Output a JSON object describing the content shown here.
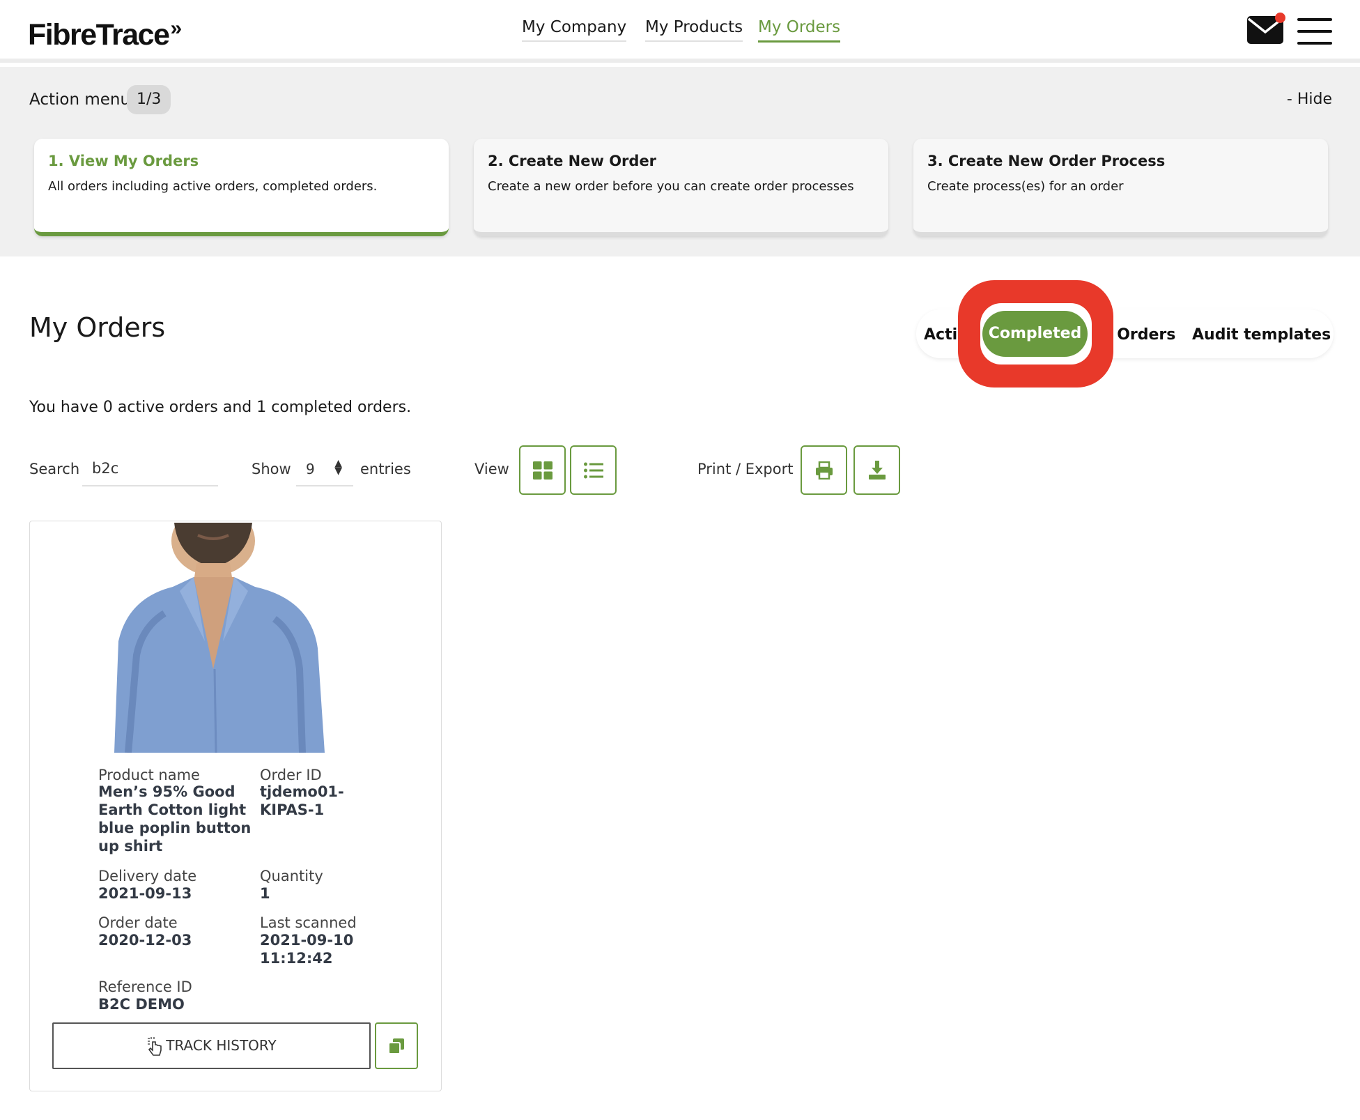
{
  "header": {
    "logo": "FibreTrace",
    "logo_mark": "»",
    "nav": [
      {
        "label": "My Company"
      },
      {
        "label": "My Products"
      },
      {
        "label": "My Orders",
        "active": true
      }
    ],
    "icons": [
      "envelope-icon",
      "notification-dot-icon",
      "hamburger-menu-icon"
    ]
  },
  "action_menu": {
    "title": "Action menu",
    "badge": "1/3",
    "hide_label": "- Hide",
    "cards": [
      {
        "title": "1. View My Orders",
        "description": "All orders including active orders, completed orders.",
        "active": true
      },
      {
        "title": "2. Create New Order",
        "description": "Create a new order before you can create order processes"
      },
      {
        "title": "3. Create New Order Process",
        "description": "Create process(es) for an order"
      }
    ]
  },
  "orders": {
    "title": "My Orders",
    "tabs": {
      "active_partial": "Acti",
      "completed": "Completed",
      "all_partial": "l Orders",
      "audit": "Audit templates"
    },
    "summary": "You have 0 active orders and 1 completed orders.",
    "search_label": "Search",
    "search_value": "b2c",
    "show_label": "Show",
    "show_value": "9",
    "entries_label": "entries",
    "view_label": "View",
    "print_export_label": "Print / Export",
    "view_icons": [
      "grid-view-icon",
      "list-view-icon"
    ],
    "export_icons": [
      "print-icon",
      "download-icon"
    ]
  },
  "order_card": {
    "image": "product-photo-blue-shirt",
    "product_name_label": "Product name",
    "product_name": [
      "Men’s 95% Good",
      "Earth Cotton light",
      "blue poplin button",
      "up shirt"
    ],
    "order_id_label": "Order ID",
    "order_id": [
      "tjdemo01-",
      "KIPAS-1"
    ],
    "delivery_date_label": "Delivery date",
    "delivery_date": "2021-09-13",
    "quantity_label": "Quantity",
    "quantity": "1",
    "order_date_label": "Order date",
    "order_date": "2020-12-03",
    "last_scanned_label": "Last scanned",
    "last_scanned": [
      "2021-09-10",
      "11:12:42"
    ],
    "reference_id_label": "Reference ID",
    "reference_id": "B2C DEMO",
    "track_history_label": "TRACK HISTORY"
  },
  "colors": {
    "accent": "#6a9a3f",
    "highlight": "#e8392a",
    "text": "#1a1a1a",
    "panel_bg": "#f0f0f0"
  }
}
